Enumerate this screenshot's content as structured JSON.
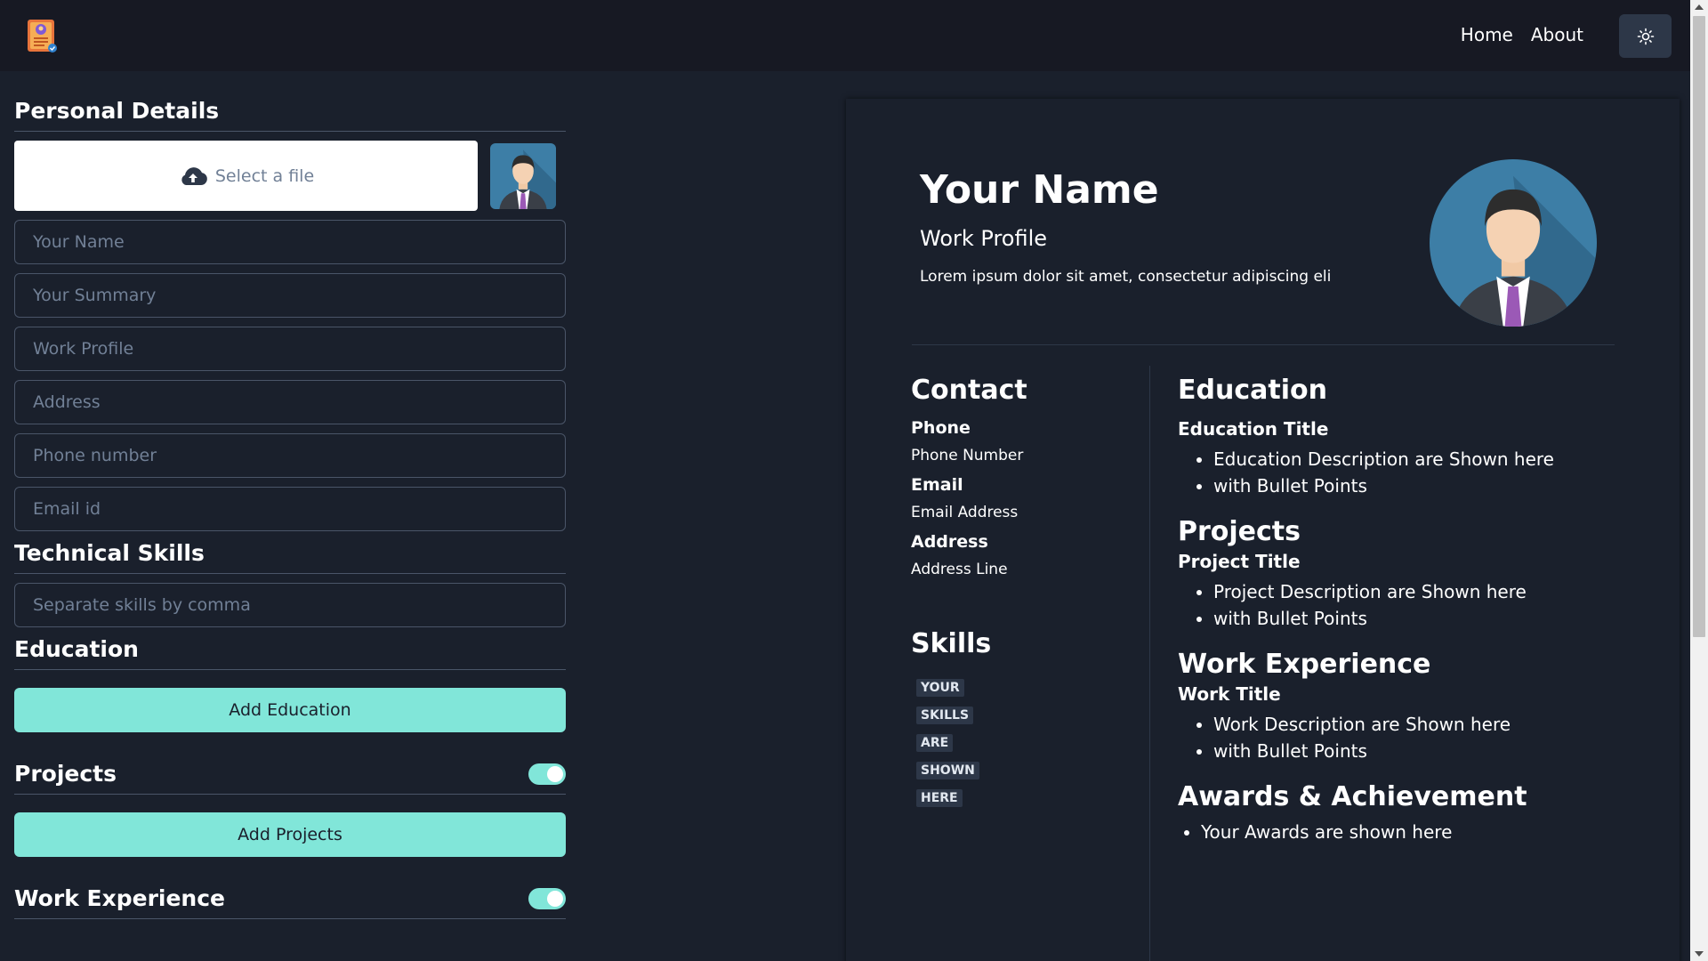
{
  "nav": {
    "links": [
      "Home",
      "About"
    ]
  },
  "editor": {
    "personal_heading": "Personal Details",
    "file_label": "Select a file",
    "fields": [
      {
        "placeholder": "Your Name"
      },
      {
        "placeholder": "Your Summary"
      },
      {
        "placeholder": "Work Profile"
      },
      {
        "placeholder": "Address"
      },
      {
        "placeholder": "Phone number"
      },
      {
        "placeholder": "Email id"
      }
    ],
    "skills_heading": "Technical Skills",
    "skills_placeholder": "Separate skills by comma",
    "education_heading": "Education",
    "add_education": "Add Education",
    "projects_heading": "Projects",
    "add_projects": "Add Projects",
    "work_heading": "Work Experience",
    "projects_toggle_on": true,
    "work_toggle_on": true
  },
  "resume": {
    "name": "Your Name",
    "profile": "Work Profile",
    "summary": "Lorem ipsum dolor sit amet, consectetur adipiscing eli",
    "contact_heading": "Contact",
    "phone_label": "Phone",
    "phone_value": "Phone Number",
    "email_label": "Email",
    "email_value": "Email Address",
    "address_label": "Address",
    "address_value": "Address Line",
    "skills_heading": "Skills",
    "skills": [
      "YOUR",
      "SKILLS",
      "ARE",
      "SHOWN",
      "HERE"
    ],
    "education_heading": "Education",
    "education_title": "Education Title",
    "education_points": [
      "Education Description are Shown here",
      "with Bullet Points"
    ],
    "projects_heading": "Projects",
    "project_title": "Project Title",
    "project_points": [
      "Project Description are Shown here",
      "with Bullet Points"
    ],
    "work_heading": "Work Experience",
    "work_title": "Work Title",
    "work_points": [
      "Work Description are Shown here",
      "with Bullet Points"
    ],
    "awards_heading": "Awards & Achievement",
    "awards_points": [
      "Your Awards are shown here"
    ]
  },
  "colors": {
    "accent": "#81e6d9",
    "background": "#1a202c",
    "navbar": "#171923"
  },
  "icons": [
    "logo-icon",
    "sun-icon",
    "cloud-upload-icon",
    "avatar-icon"
  ]
}
